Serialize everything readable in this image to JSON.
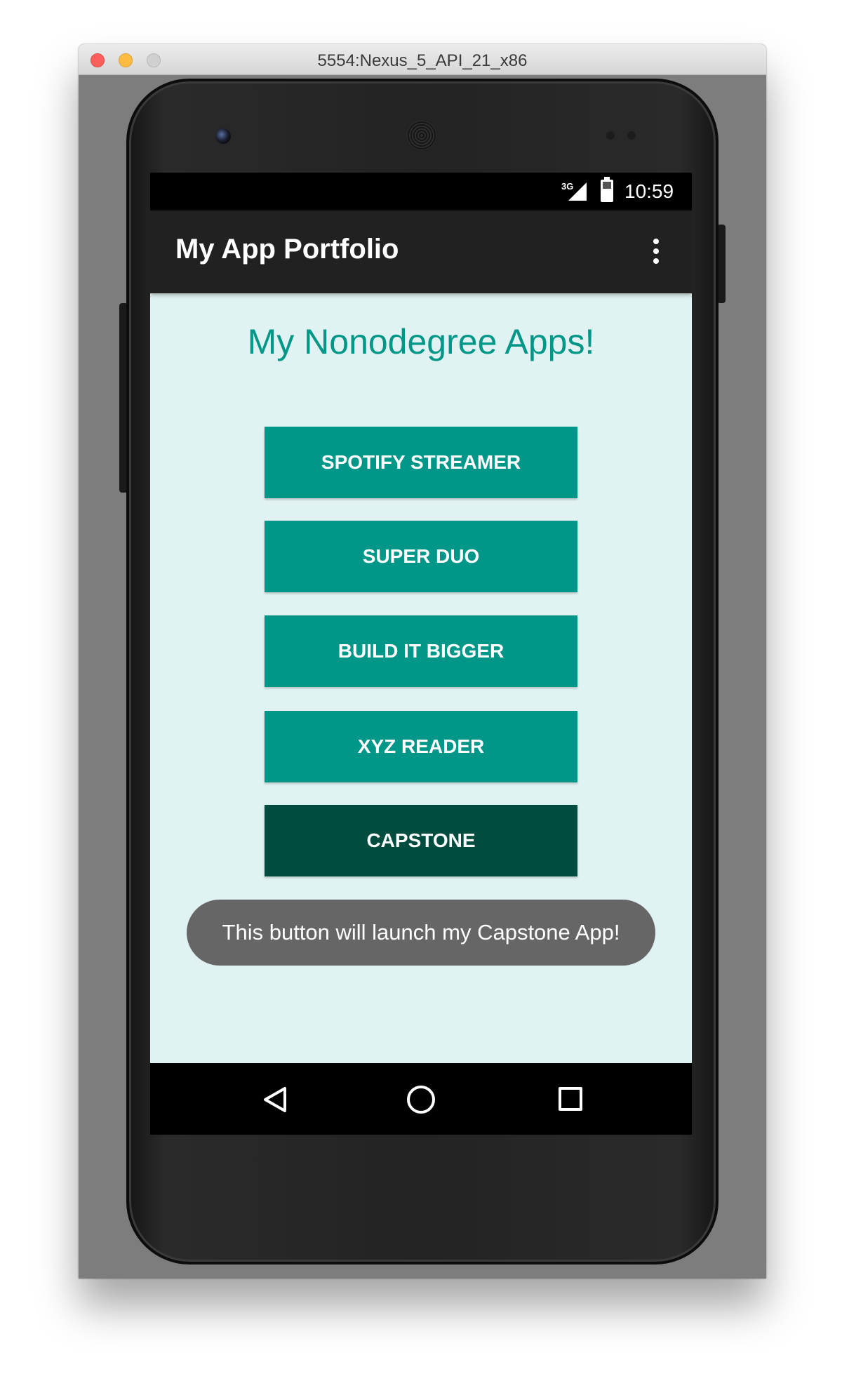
{
  "window": {
    "title": "5554:Nexus_5_API_21_x86"
  },
  "statusbar": {
    "network": "3G",
    "time": "10:59"
  },
  "appbar": {
    "title": "My App Portfolio",
    "menu_icon": "more-vert-icon"
  },
  "main": {
    "headline": "My Nonodegree Apps!",
    "buttons": [
      {
        "label": "SPOTIFY STREAMER"
      },
      {
        "label": "SUPER DUO"
      },
      {
        "label": "BUILD IT BIGGER"
      },
      {
        "label": "XYZ READER"
      },
      {
        "label": "CAPSTONE"
      }
    ],
    "toast": "This button will launch my Capstone App!"
  },
  "navbar": {
    "icons": [
      "back-icon",
      "home-icon",
      "recents-icon"
    ]
  },
  "colors": {
    "accent": "#009688",
    "pressed": "#004d40",
    "screen_background": "#e0f2f1",
    "appbar": "#212121",
    "toast": "#666666"
  }
}
